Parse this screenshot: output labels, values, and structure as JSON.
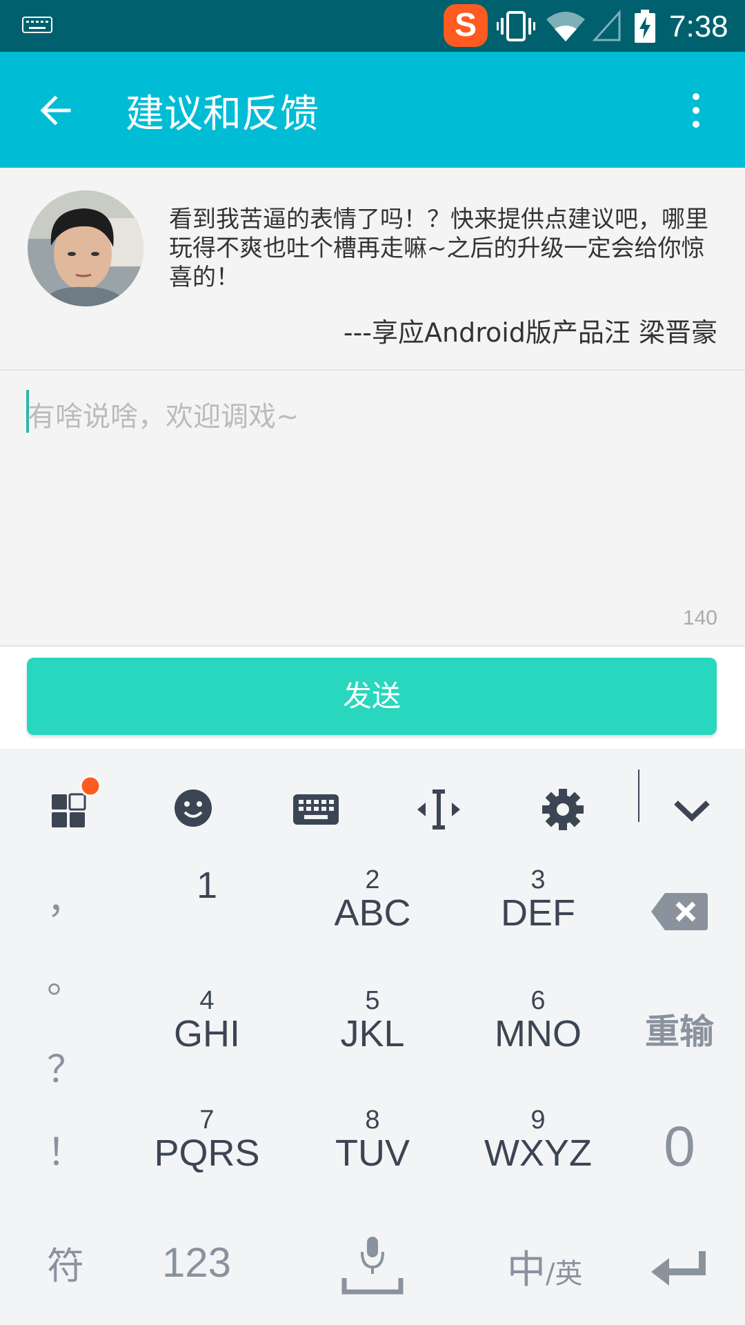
{
  "status_bar": {
    "time": "7:38",
    "app_badge": "S",
    "icons": [
      "keyboard-icon",
      "sogou-icon",
      "vibrate-icon",
      "wifi-icon",
      "signal-icon",
      "battery-charging-icon"
    ]
  },
  "appbar": {
    "title": "建议和反馈",
    "back_icon": "arrow-left-icon",
    "more_icon": "more-vert-icon"
  },
  "intro": {
    "message": "看到我苦逼的表情了吗！？快来提供点建议吧，哪里玩得不爽也吐个槽再走嘛~之后的升级一定会给你惊喜的！",
    "signature": "---享应Android版产品汪 梁晋豪"
  },
  "feedback": {
    "placeholder": "有啥说啥，欢迎调戏~",
    "char_limit": "140"
  },
  "send_button": "发送",
  "keyboard": {
    "toolbar": [
      "apps-icon",
      "emoji-icon",
      "keyboard-icon",
      "cursor-move-icon",
      "settings-icon",
      "chevron-down-icon"
    ],
    "punctuation": [
      "，",
      "。",
      "？",
      "！"
    ],
    "keys": [
      {
        "num": "",
        "letters": "1"
      },
      {
        "num": "2",
        "letters": "ABC"
      },
      {
        "num": "3",
        "letters": "DEF"
      },
      {
        "num": "4",
        "letters": "GHI"
      },
      {
        "num": "5",
        "letters": "JKL"
      },
      {
        "num": "6",
        "letters": "MNO"
      },
      {
        "num": "7",
        "letters": "PQRS"
      },
      {
        "num": "8",
        "letters": "TUV"
      },
      {
        "num": "9",
        "letters": "WXYZ"
      }
    ],
    "reenter": "重输",
    "zero": "0",
    "symbols": "符",
    "numbers": "123",
    "lang_main": "中",
    "lang_alt": "/英"
  },
  "colors": {
    "status_bar": "#00606e",
    "app_bar": "#00bcd4",
    "send_button": "#28d7bd",
    "keyboard_text": "#3c4554"
  }
}
